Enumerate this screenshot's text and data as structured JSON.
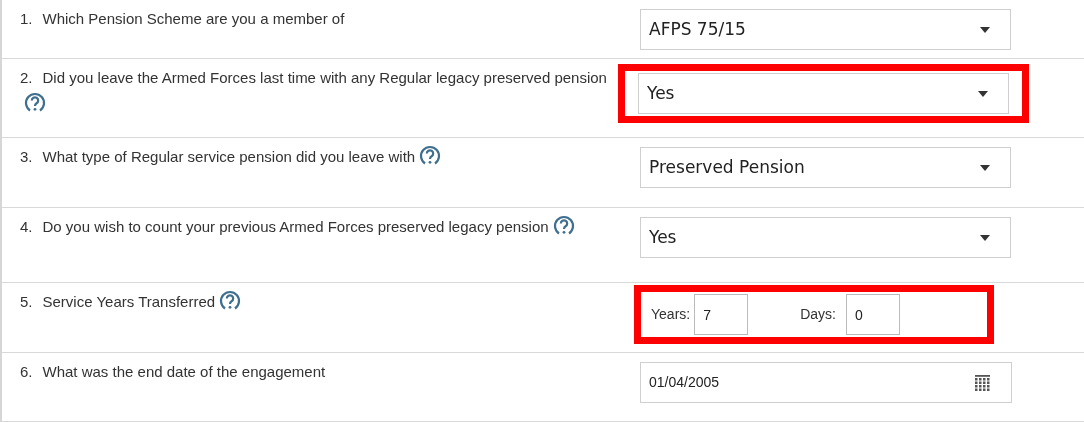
{
  "questions": [
    {
      "number": "1.",
      "text": "Which Pension Scheme are you a member of",
      "help": false,
      "highlighted": false,
      "kind": "select",
      "value": "AFPS 75/15"
    },
    {
      "number": "2.",
      "text": "Did you leave the Armed Forces last time with any Regular legacy preserved pension",
      "help": true,
      "highlighted": true,
      "kind": "select",
      "value": "Yes"
    },
    {
      "number": "3.",
      "text": "What type of Regular service pension did you leave with",
      "help": true,
      "highlighted": false,
      "kind": "select",
      "value": "Preserved Pension"
    },
    {
      "number": "4.",
      "text": "Do you wish to count your previous Armed Forces preserved legacy pension",
      "help": true,
      "highlighted": false,
      "kind": "select",
      "value": "Yes"
    },
    {
      "number": "5.",
      "text": "Service Years Transferred",
      "help": true,
      "highlighted": true,
      "kind": "years_days",
      "years_label": "Years:",
      "years": "7",
      "days_label": "Days:",
      "days": "0"
    },
    {
      "number": "6.",
      "text": "What was the end date of the engagement",
      "help": false,
      "highlighted": false,
      "kind": "date",
      "value": "01/04/2005"
    }
  ]
}
